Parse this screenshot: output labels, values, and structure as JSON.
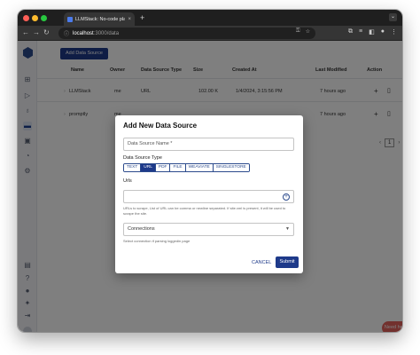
{
  "browser": {
    "tab_title": "LLMStack: No-code platform",
    "tab_close": "×",
    "new_tab": "+",
    "url_host": "localhost",
    "url_path": ":3000/data",
    "colors": {
      "close": "#fe5f57",
      "minimize": "#febc2e",
      "maximize": "#28c840"
    }
  },
  "header": {
    "add_button": "Add Data Source"
  },
  "table": {
    "columns": [
      "Name",
      "Owner",
      "Data Source Type",
      "Size",
      "Created At",
      "Last Modified",
      "Action"
    ],
    "rows": [
      {
        "name": "LLMStack",
        "owner": "me",
        "type": "URL",
        "size": "102.00 K",
        "created": "1/4/2024, 3:15:56 PM",
        "modified": "7 hours ago"
      },
      {
        "name": "promptly",
        "owner": "me",
        "type": "",
        "size": "",
        "created": "",
        "modified": "7 hours ago"
      }
    ]
  },
  "pagination": {
    "page": "1"
  },
  "modal": {
    "title": "Add New Data Source",
    "name_placeholder": "Data Source Name *",
    "type_label": "Data Source Type",
    "types": [
      "TEXT",
      "URL",
      "PDF",
      "FILE",
      "WEAVIATE",
      "SINGLESTORE"
    ],
    "selected_type": "URL",
    "urls_label": "Urls",
    "urls_help": "URLs to scrape, List of URL can be comma or newline separated. If site.xml is present, it will be used to scrape the site.",
    "connections_label": "Connections",
    "connections_help": "Select connection if parsing loggedin page",
    "cancel": "CANCEL",
    "submit": "Submit"
  },
  "help_button": "Need help?",
  "accent_color": "#1e3a8a"
}
